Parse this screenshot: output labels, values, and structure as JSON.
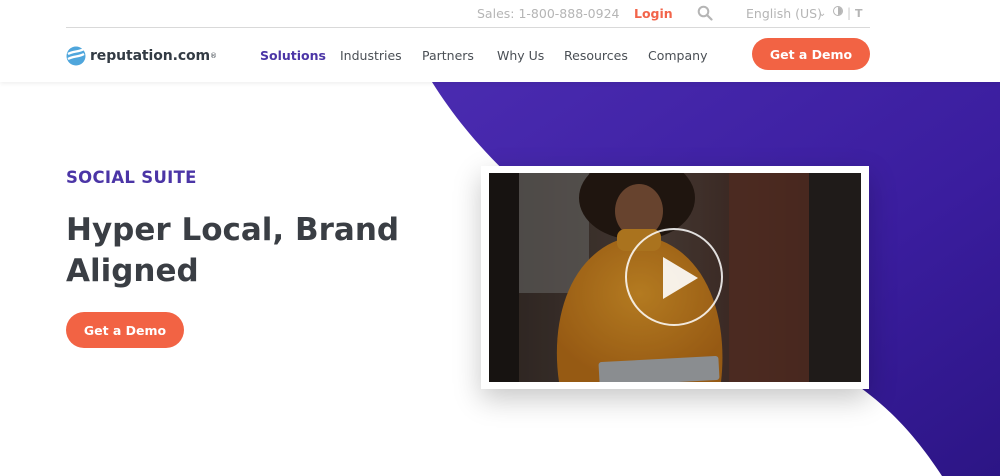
{
  "utility": {
    "sales_phone": "Sales: 1-800-888-0924",
    "login": "Login",
    "language": "English (US)",
    "separator": "|",
    "text_size": "T"
  },
  "logo": {
    "text": "reputation.com",
    "registered": "®"
  },
  "nav": {
    "items": [
      {
        "label": "Solutions",
        "active": true
      },
      {
        "label": "Industries"
      },
      {
        "label": "Partners"
      },
      {
        "label": "Why Us"
      },
      {
        "label": "Resources"
      },
      {
        "label": "Company"
      }
    ]
  },
  "header": {
    "cta_label": "Get a Demo"
  },
  "hero": {
    "eyebrow": "SOCIAL SUITE",
    "headline": "Hyper Local, Brand Aligned",
    "cta_label": "Get a Demo"
  },
  "icons": {
    "search": "search-icon",
    "play": "play-icon",
    "chevron": "chevron-down-icon",
    "contrast": "contrast-icon",
    "text_size": "text-size-icon"
  },
  "colors": {
    "accent_orange": "#f26344",
    "brand_purple": "#4b35a6",
    "hero_shape_purple": "#3f1fa3",
    "text_dark": "#3a3e44"
  }
}
